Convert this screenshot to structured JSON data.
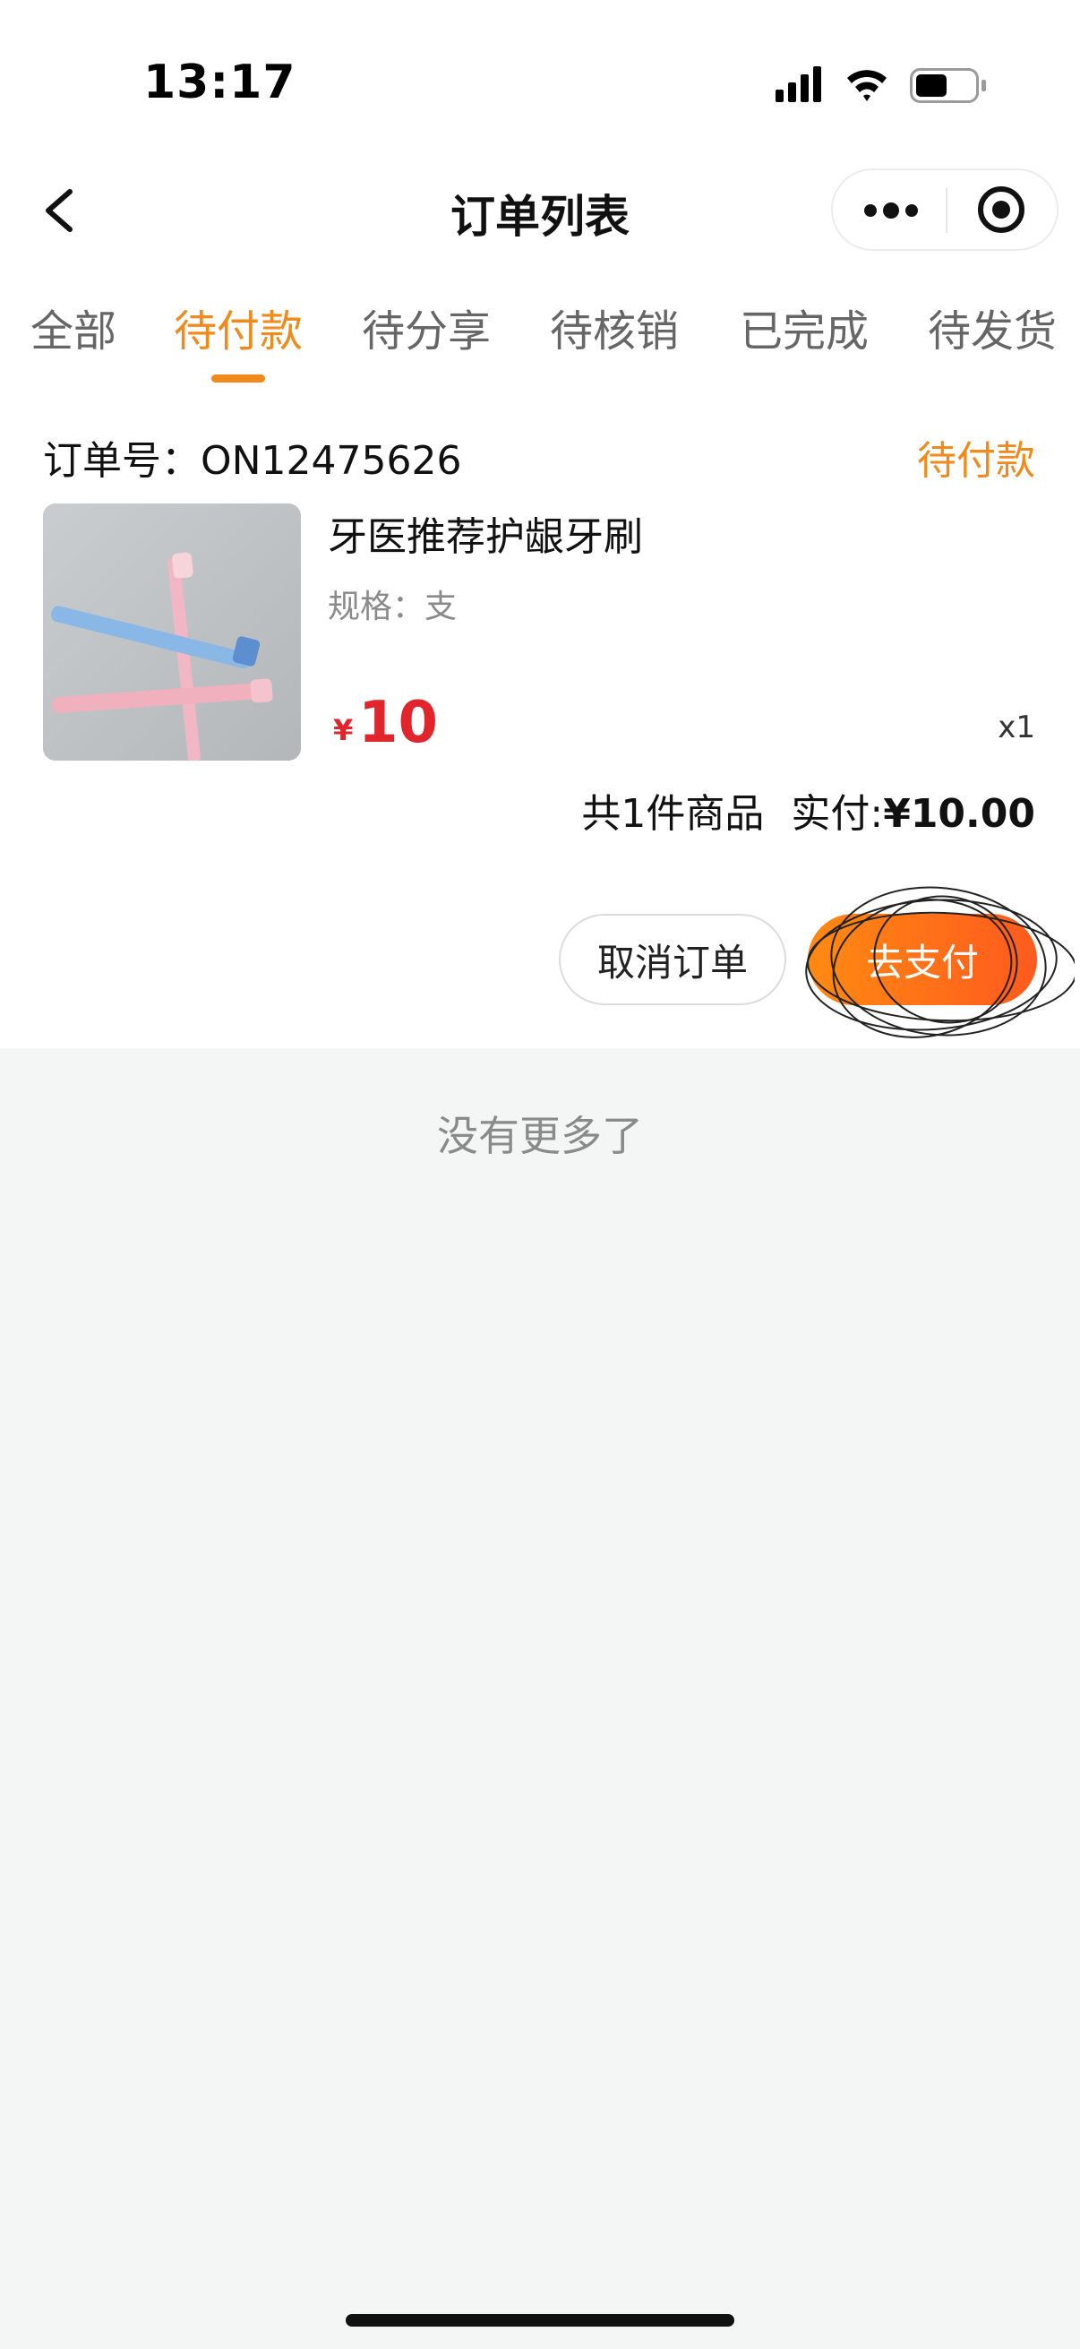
{
  "status_bar": {
    "time": "13:17",
    "icons": [
      "cellular-signal-icon",
      "wifi-icon",
      "battery-icon"
    ]
  },
  "nav": {
    "title": "订单列表",
    "back_icon": "chevron-left-icon",
    "more_icon": "more-dots-icon",
    "target_icon": "target-circle-icon"
  },
  "tabs": [
    {
      "label": "全部"
    },
    {
      "label": "待付款",
      "active": true
    },
    {
      "label": "待分享"
    },
    {
      "label": "待核销"
    },
    {
      "label": "已完成"
    },
    {
      "label": "待发货"
    }
  ],
  "order": {
    "order_no": "订单号：ON12475626",
    "status": "待付款",
    "product": {
      "name": "牙医推荐护龈牙刷",
      "spec": "规格：支",
      "price_symbol": "¥",
      "price": "10",
      "quantity": "x1"
    },
    "summary": {
      "count_text": "共1件商品",
      "paid_label": "实付:",
      "paid_amount": "¥10.00"
    },
    "actions": {
      "cancel_label": "取消订单",
      "pay_label": "去支付"
    }
  },
  "footer": {
    "no_more_text": "没有更多了"
  },
  "colors": {
    "accent": "#f08a1c",
    "price": "#e0262c",
    "pay_gradient_start": "#ff8a12",
    "pay_gradient_end": "#ff5a1e",
    "page_background": "#f4f5f5"
  }
}
